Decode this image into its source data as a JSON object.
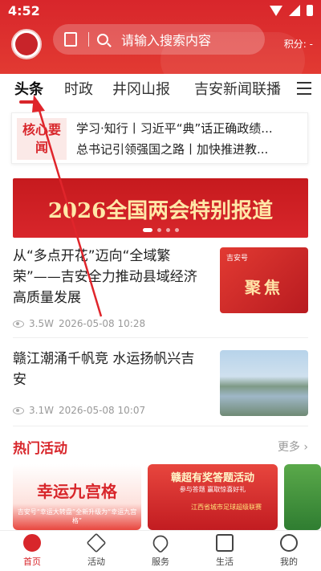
{
  "status_bar": {
    "time": "4:52"
  },
  "header": {
    "search_placeholder": "请输入搜索内容",
    "points_label": "积分: -"
  },
  "tabs": [
    {
      "label": "头条"
    },
    {
      "label": "时政"
    },
    {
      "label": "井冈山报"
    },
    {
      "label": "吉安新闻联播"
    }
  ],
  "headline": {
    "tag": "核心要闻",
    "lines": [
      "学习·知行丨习近平“典”话正确政绩...",
      "总书记引领强国之路丨加快推进教..."
    ]
  },
  "banner": {
    "text": "2026全国两会特别报道"
  },
  "news": [
    {
      "title": "从“多点开花”迈向“全域繁荣”——吉安全力推动县域经济高质量发展",
      "views": "3.5W",
      "date": "2026-05-08 10:28",
      "thumb_badge": "吉安号",
      "thumb_text": "聚焦"
    },
    {
      "title": "赣江潮涌千帆竞 水运扬帆兴吉安",
      "views": "3.1W",
      "date": "2026-05-08 10:07"
    }
  ],
  "hot": {
    "title": "热门活动",
    "more": "更多",
    "cards": [
      {
        "title": "幸运九宫格",
        "subtitle": "吉安号“幸运大转盘”全新升级为“幸运九宫格”"
      },
      {
        "title": "赣超有奖答题活动",
        "subtitle": "参与答题 赢取惊喜好礼",
        "banner": "江西省城市足球超级联赛"
      }
    ]
  },
  "bottom_nav": [
    {
      "label": "首页"
    },
    {
      "label": "活动"
    },
    {
      "label": "服务"
    },
    {
      "label": "生活"
    },
    {
      "label": "我的"
    }
  ],
  "colors": {
    "brand_red": "#d8262b",
    "text_dark": "#222222",
    "meta_gray": "#999999"
  }
}
